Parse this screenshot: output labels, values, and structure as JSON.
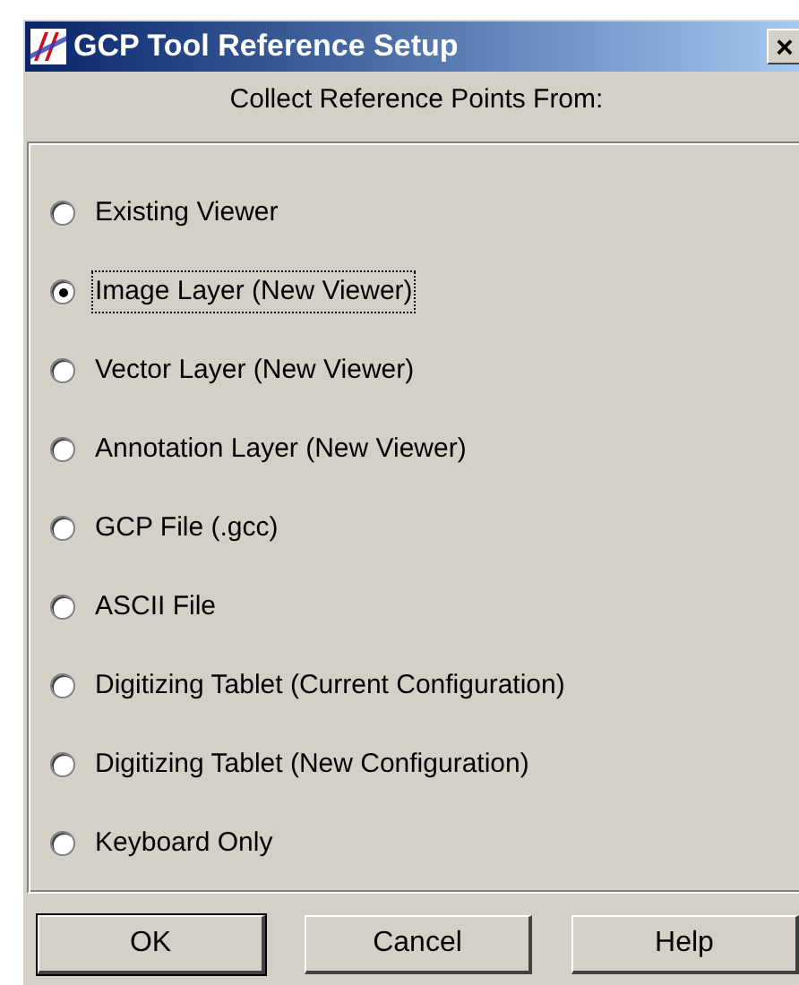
{
  "window": {
    "title": "GCP Tool Reference Setup",
    "close": "×"
  },
  "heading": "Collect Reference Points From:",
  "options": [
    {
      "label": "Existing Viewer",
      "selected": false
    },
    {
      "label": "Image Layer (New Viewer)",
      "selected": true
    },
    {
      "label": "Vector Layer (New Viewer)",
      "selected": false
    },
    {
      "label": "Annotation Layer (New Viewer)",
      "selected": false
    },
    {
      "label": "GCP File (.gcc)",
      "selected": false
    },
    {
      "label": "ASCII File",
      "selected": false
    },
    {
      "label": "Digitizing Tablet (Current Configuration)",
      "selected": false
    },
    {
      "label": "Digitizing Tablet (New Configuration)",
      "selected": false
    },
    {
      "label": "Keyboard Only",
      "selected": false
    }
  ],
  "buttons": [
    {
      "label": "OK",
      "default": true
    },
    {
      "label": "Cancel",
      "default": false
    },
    {
      "label": "Help",
      "default": false
    }
  ]
}
